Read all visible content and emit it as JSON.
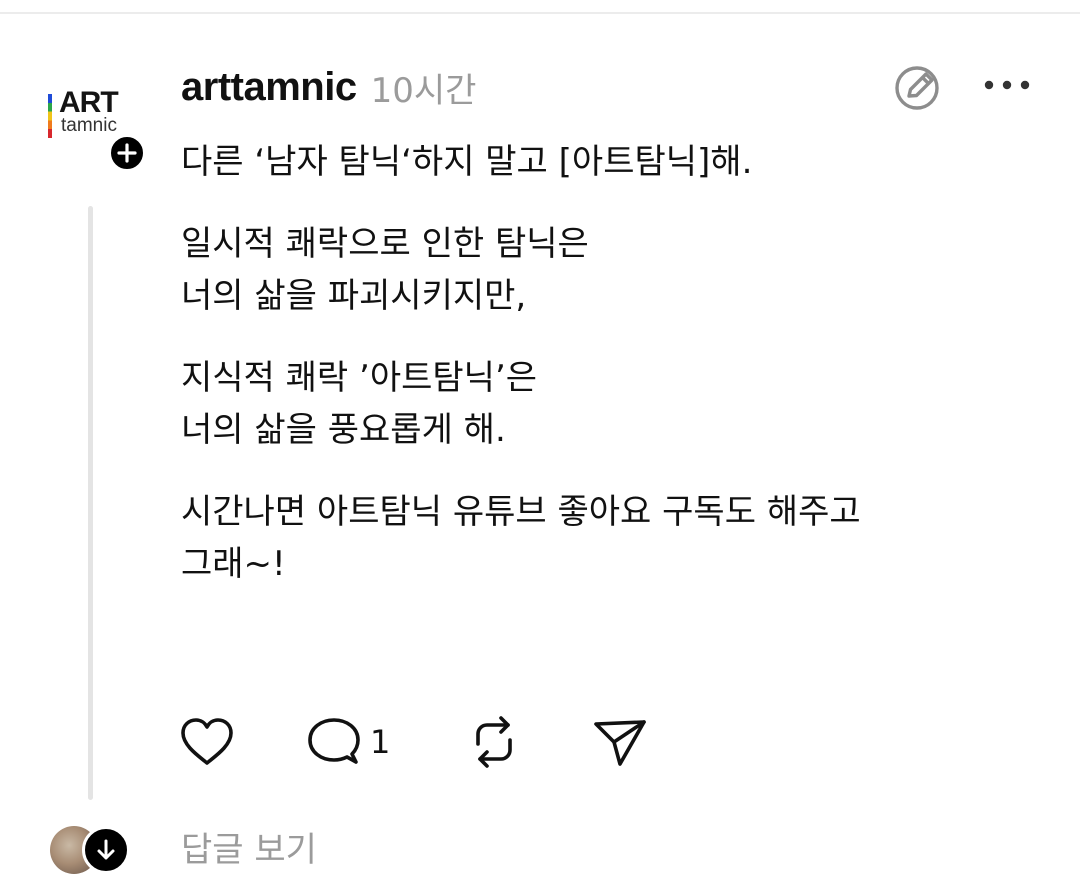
{
  "post": {
    "avatar": {
      "logo_text": "ART",
      "logo_subtext": "tamnic"
    },
    "username": "arttamnic",
    "timestamp": "10시간",
    "paragraphs": [
      "다른 ‘남자 탐닉‘하지 말고 [아트탐닉]해.",
      "일시적 쾌락으로 인한 탐닉은\n너의 삶을 파괴시키지만,",
      "지식적 쾌락 ’아트탐닉’은\n너의 삶을 풍요롭게 해.",
      "시간나면 아트탐닉 유튜브 좋아요 구독도 해주고\n그래~!"
    ],
    "actions": {
      "like_icon": "heart-icon",
      "reply_icon": "comment-icon",
      "reply_count": "1",
      "repost_icon": "repost-icon",
      "share_icon": "send-icon"
    }
  },
  "replies": {
    "label": "답글 보기",
    "expand_icon": "arrow-down-icon"
  },
  "colors": {
    "text": "#111111",
    "muted": "#9b9b9b",
    "thread_line": "#e4e4e4",
    "follow_button": "#000000"
  }
}
